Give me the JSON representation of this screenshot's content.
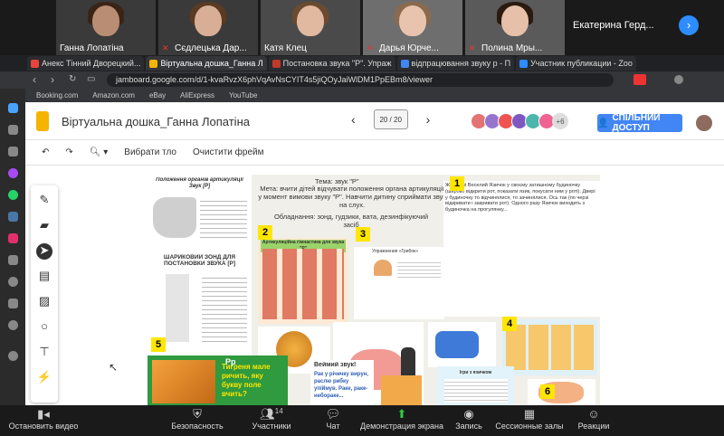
{
  "video": {
    "tiles": [
      {
        "name": "Ганна Лопатіна"
      },
      {
        "name": "Сєдлецька Дар..."
      },
      {
        "name": "Катя Клец"
      },
      {
        "name": "Дарья Юрче..."
      },
      {
        "name": "Полина Мры..."
      },
      {
        "name": "Екатерина Герд..."
      }
    ]
  },
  "browser": {
    "tabs": [
      {
        "label": "Анекс Тінний Дворецкий...",
        "color": "#e8453c"
      },
      {
        "label": "Віртуальна дошка_Ганна Л",
        "color": "#f4b400",
        "active": true
      },
      {
        "label": "Постановка звука \"Р\". Упраж",
        "color": "#c0392b"
      },
      {
        "label": "відпрацювання звуку р - П",
        "color": "#4285f4"
      },
      {
        "label": "Участник публикации - Zoo",
        "color": "#2d8cff"
      }
    ],
    "url": "jamboard.google.com/d/1-kvaRvzX6phVqAvNsCYIT4s5jiQOyJaiWlDM1PpEBm8/viewer",
    "bookmarks": [
      "Booking.com",
      "Amazon.com",
      "eBay",
      "AliExpress",
      "YouTube"
    ]
  },
  "jamboard": {
    "title": "Віртуальна дошка_Ганна Лопатіна",
    "frame_label": "20 / 20",
    "more_count": "+6",
    "share_label": "СПІЛЬНИЙ ДОСТУП",
    "toolbar": {
      "zoom": "",
      "background": "Вибрати тло",
      "clear": "Очистити фрейм"
    },
    "board": {
      "heading": "Тема: звук \"Р\"",
      "goal": "Мета: вчити дітей відчувати положення органа артикуляції у момент вимови звуку \"Р\". Навчити дитину сприймати звук на слух.",
      "equipment": "Обладнання: зонд, гудзики, вата, дезинфікуючий засіб",
      "panel1_title": "Положення органів артикуляції Звук [Р]",
      "panel1_zone_title": "ШАРИКОВИЙ ЗОНД ДЛЯ ПОСТАНОВКИ ЗВУКА [Р]",
      "story": "Жив собі Веселий Язичок у своєму затишному будиночку (широко відкрити рот, показати язик, покусати ним у роті). Двері у будиночку то відчинялися, то зачинялися. Ось так (по черзі відкривати і закривати рот). Одного разу Язичок виходить з будиночка на прогулянку...",
      "panel2_title": "Артикуляційна гімнастика для звука \"Р\"",
      "panel3_title": "Упражнения «Грибок»",
      "tiger_text": "Тигреня мале ричить, яку букву поле вчить?",
      "tiger_sub": "Pp",
      "weak_title": "Веймий звук!",
      "weak_text": "Рак у річечку вирун, раслю рибку упіймув. Раке, раке-небораке...",
      "panel6_title": "Ігри з язичком",
      "badges": [
        "1",
        "2",
        "3",
        "4",
        "5",
        "6"
      ]
    }
  },
  "zoom_bar": {
    "stop_video": "Остановить видео",
    "security": "Безопасность",
    "participants": "Участники",
    "participants_count": "14",
    "chat": "Чат",
    "share": "Демонстрация экрана",
    "record": "Запись",
    "rooms": "Сессионные залы",
    "reactions": "Реакции"
  },
  "colors": {
    "share_button": "#4285f4",
    "zoom_share": "#2ecc40",
    "jam_logo": "#f4b400",
    "badge": "#ffe600"
  }
}
